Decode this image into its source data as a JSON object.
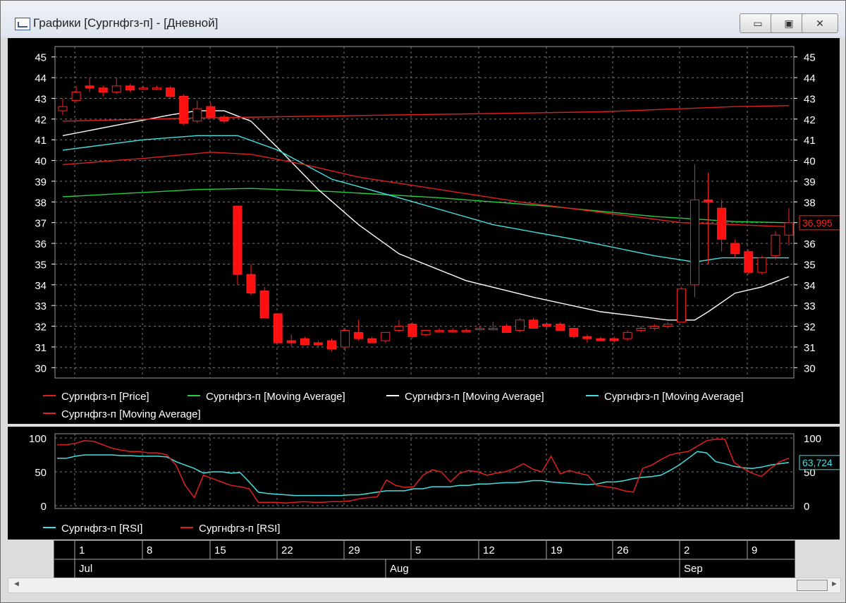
{
  "window": {
    "title": "Графики [Сургнфгз-п] - [Дневной]",
    "minimize_label": "▭",
    "maximize_label": "▣",
    "close_label": "✕"
  },
  "price_panel": {
    "y_ticks": [
      30,
      31,
      32,
      33,
      34,
      35,
      36,
      37,
      38,
      39,
      40,
      41,
      42,
      43,
      44,
      45
    ],
    "last_price_label": "36,995",
    "legend": [
      {
        "text": "Сургнфгз-п [Price]",
        "color": "#e02020"
      },
      {
        "text": "Сургнфгз-п [Moving Average]",
        "color": "#20d040"
      },
      {
        "text": "Сургнфгз-п [Moving Average]",
        "color": "#ffffff"
      },
      {
        "text": "Сургнфгз-п [Moving Average]",
        "color": "#40e0e0"
      },
      {
        "text": "Сургнфгз-п [Moving Average]",
        "color": "#e02020"
      }
    ]
  },
  "rsi_panel": {
    "y_ticks": [
      0,
      50,
      100
    ],
    "last_rsi_label": "63,724",
    "legend": [
      {
        "text": "Сургнфгз-п [RSI]",
        "color": "#40e0e0"
      },
      {
        "text": "Сургнфгз-п [RSI]",
        "color": "#e02020"
      }
    ]
  },
  "date_axis": {
    "days": [
      "1",
      "8",
      "15",
      "22",
      "29",
      "5",
      "12",
      "19",
      "26",
      "2",
      "9"
    ],
    "months": [
      "Jul",
      "Aug",
      "Sep"
    ]
  },
  "chart_data": [
    {
      "type": "candlestick",
      "ylim": [
        29.5,
        45.5
      ],
      "candles": [
        {
          "o": 42.4,
          "h": 43.0,
          "l": 42.2,
          "c": 42.6,
          "color": "red"
        },
        {
          "o": 42.9,
          "h": 43.6,
          "l": 42.8,
          "c": 43.3,
          "color": "red"
        },
        {
          "o": 43.6,
          "h": 44.0,
          "l": 43.3,
          "c": 43.5,
          "color": "red"
        },
        {
          "o": 43.5,
          "h": 43.6,
          "l": 43.1,
          "c": 43.3,
          "color": "red"
        },
        {
          "o": 43.3,
          "h": 44.0,
          "l": 43.2,
          "c": 43.6,
          "color": "red"
        },
        {
          "o": 43.6,
          "h": 43.7,
          "l": 43.3,
          "c": 43.4,
          "color": "red"
        },
        {
          "o": 43.5,
          "h": 43.6,
          "l": 43.4,
          "c": 43.5,
          "color": "red"
        },
        {
          "o": 43.5,
          "h": 43.6,
          "l": 43.4,
          "c": 43.5,
          "color": "red"
        },
        {
          "o": 43.5,
          "h": 43.6,
          "l": 43.0,
          "c": 43.1,
          "color": "red"
        },
        {
          "o": 43.1,
          "h": 43.2,
          "l": 41.7,
          "c": 41.8,
          "color": "red"
        },
        {
          "o": 41.9,
          "h": 42.9,
          "l": 41.8,
          "c": 42.5,
          "color": "red"
        },
        {
          "o": 42.6,
          "h": 42.8,
          "l": 42.0,
          "c": 42.1,
          "color": "red"
        },
        {
          "o": 42.1,
          "h": 42.2,
          "l": 41.8,
          "c": 41.9,
          "color": "red"
        },
        {
          "o": 37.8,
          "h": 37.8,
          "l": 34.0,
          "c": 34.5,
          "color": "red"
        },
        {
          "o": 34.5,
          "h": 35.0,
          "l": 33.5,
          "c": 33.6,
          "color": "red"
        },
        {
          "o": 33.7,
          "h": 33.9,
          "l": 32.4,
          "c": 32.4,
          "color": "red"
        },
        {
          "o": 32.6,
          "h": 32.6,
          "l": 31.2,
          "c": 31.2,
          "color": "red"
        },
        {
          "o": 31.3,
          "h": 31.6,
          "l": 31.0,
          "c": 31.2,
          "color": "red"
        },
        {
          "o": 31.4,
          "h": 31.5,
          "l": 31.1,
          "c": 31.1,
          "color": "red"
        },
        {
          "o": 31.2,
          "h": 31.3,
          "l": 31.0,
          "c": 31.1,
          "color": "red"
        },
        {
          "o": 31.3,
          "h": 31.4,
          "l": 30.8,
          "c": 30.9,
          "color": "red"
        },
        {
          "o": 31.0,
          "h": 31.9,
          "l": 30.8,
          "c": 31.8,
          "color": "red"
        },
        {
          "o": 31.7,
          "h": 32.3,
          "l": 31.3,
          "c": 31.4,
          "color": "red"
        },
        {
          "o": 31.4,
          "h": 31.5,
          "l": 31.2,
          "c": 31.2,
          "color": "red"
        },
        {
          "o": 31.3,
          "h": 31.7,
          "l": 31.2,
          "c": 31.7,
          "color": "red"
        },
        {
          "o": 31.8,
          "h": 32.3,
          "l": 31.7,
          "c": 32.0,
          "color": "red"
        },
        {
          "o": 32.1,
          "h": 32.2,
          "l": 31.4,
          "c": 31.5,
          "color": "red"
        },
        {
          "o": 31.6,
          "h": 31.8,
          "l": 31.5,
          "c": 31.8,
          "color": "red"
        },
        {
          "o": 31.8,
          "h": 31.9,
          "l": 31.7,
          "c": 31.8,
          "color": "red"
        },
        {
          "o": 31.8,
          "h": 31.9,
          "l": 31.7,
          "c": 31.8,
          "color": "red"
        },
        {
          "o": 31.8,
          "h": 31.9,
          "l": 31.7,
          "c": 31.8,
          "color": "red"
        },
        {
          "o": 31.9,
          "h": 32.0,
          "l": 31.8,
          "c": 31.9,
          "color": "red"
        },
        {
          "o": 31.9,
          "h": 32.2,
          "l": 31.8,
          "c": 31.9,
          "color": "red"
        },
        {
          "o": 32.0,
          "h": 32.1,
          "l": 31.7,
          "c": 31.7,
          "color": "red"
        },
        {
          "o": 31.8,
          "h": 32.4,
          "l": 31.7,
          "c": 32.3,
          "color": "red"
        },
        {
          "o": 32.3,
          "h": 32.4,
          "l": 31.9,
          "c": 31.9,
          "color": "red"
        },
        {
          "o": 32.1,
          "h": 32.2,
          "l": 31.9,
          "c": 32.0,
          "color": "red"
        },
        {
          "o": 32.1,
          "h": 32.2,
          "l": 31.8,
          "c": 31.8,
          "color": "red"
        },
        {
          "o": 31.9,
          "h": 31.9,
          "l": 31.4,
          "c": 31.5,
          "color": "red"
        },
        {
          "o": 31.5,
          "h": 31.6,
          "l": 31.2,
          "c": 31.4,
          "color": "red"
        },
        {
          "o": 31.4,
          "h": 31.5,
          "l": 31.3,
          "c": 31.3,
          "color": "red"
        },
        {
          "o": 31.4,
          "h": 31.5,
          "l": 31.2,
          "c": 31.3,
          "color": "red"
        },
        {
          "o": 31.4,
          "h": 31.8,
          "l": 31.3,
          "c": 31.7,
          "color": "red"
        },
        {
          "o": 31.8,
          "h": 32.0,
          "l": 31.7,
          "c": 31.9,
          "color": "red"
        },
        {
          "o": 31.9,
          "h": 32.1,
          "l": 31.8,
          "c": 32.0,
          "color": "red"
        },
        {
          "o": 32.0,
          "h": 32.2,
          "l": 31.9,
          "c": 32.1,
          "color": "red"
        },
        {
          "o": 32.2,
          "h": 33.9,
          "l": 32.2,
          "c": 33.8,
          "color": "red"
        },
        {
          "o": 34.0,
          "h": 39.8,
          "l": 33.4,
          "c": 38.1,
          "color": "red"
        },
        {
          "o": 38.1,
          "h": 39.4,
          "l": 35.0,
          "c": 38.0,
          "color": "red"
        },
        {
          "o": 37.7,
          "h": 38.1,
          "l": 35.6,
          "c": 36.2,
          "color": "red"
        },
        {
          "o": 36.0,
          "h": 36.2,
          "l": 35.3,
          "c": 35.5,
          "color": "red"
        },
        {
          "o": 35.6,
          "h": 35.7,
          "l": 34.5,
          "c": 34.6,
          "color": "red"
        },
        {
          "o": 34.6,
          "h": 35.4,
          "l": 34.5,
          "c": 35.3,
          "color": "red"
        },
        {
          "o": 35.4,
          "h": 36.6,
          "l": 35.2,
          "c": 36.4,
          "color": "red"
        },
        {
          "o": 36.4,
          "h": 37.7,
          "l": 35.9,
          "c": 36.995,
          "color": "red"
        }
      ],
      "moving_averages": [
        {
          "color": "#20d040",
          "points": [
            [
              0,
              38.25
            ],
            [
              10,
              38.6
            ],
            [
              14,
              38.65
            ],
            [
              20,
              38.5
            ],
            [
              28,
              38.2
            ],
            [
              36,
              37.8
            ],
            [
              44,
              37.3
            ],
            [
              50,
              37.05
            ],
            [
              54,
              36.995
            ]
          ]
        },
        {
          "color": "#ffffff",
          "points": [
            [
              0,
              41.2
            ],
            [
              4,
              41.7
            ],
            [
              8,
              42.2
            ],
            [
              10,
              42.4
            ],
            [
              12,
              42.4
            ],
            [
              14,
              41.9
            ],
            [
              16,
              40.6
            ],
            [
              19,
              38.6
            ],
            [
              22,
              36.9
            ],
            [
              25,
              35.5
            ],
            [
              30,
              34.2
            ],
            [
              35,
              33.4
            ],
            [
              40,
              32.7
            ],
            [
              45,
              32.3
            ],
            [
              47,
              32.3
            ],
            [
              48,
              32.7
            ],
            [
              50,
              33.6
            ],
            [
              52,
              33.9
            ],
            [
              54,
              34.4
            ]
          ]
        },
        {
          "color": "#40e0e0",
          "points": [
            [
              0,
              40.5
            ],
            [
              6,
              41.0
            ],
            [
              10,
              41.2
            ],
            [
              13,
              41.2
            ],
            [
              16,
              40.5
            ],
            [
              20,
              39.1
            ],
            [
              25,
              38.2
            ],
            [
              32,
              36.9
            ],
            [
              38,
              36.2
            ],
            [
              44,
              35.4
            ],
            [
              47,
              35.1
            ],
            [
              49,
              35.3
            ],
            [
              54,
              35.3
            ]
          ]
        },
        {
          "color": "#e02020",
          "points": [
            [
              0,
              39.8
            ],
            [
              6,
              40.1
            ],
            [
              11,
              40.4
            ],
            [
              14,
              40.3
            ],
            [
              18,
              39.8
            ],
            [
              22,
              39.2
            ],
            [
              28,
              38.6
            ],
            [
              34,
              38.0
            ],
            [
              40,
              37.5
            ],
            [
              46,
              37.0
            ],
            [
              50,
              36.9
            ],
            [
              54,
              36.8
            ]
          ]
        },
        {
          "color": "#e02020",
          "points": [
            [
              0,
              41.9
            ],
            [
              10,
              42.05
            ],
            [
              20,
              42.15
            ],
            [
              30,
              42.25
            ],
            [
              40,
              42.35
            ],
            [
              50,
              42.6
            ],
            [
              54,
              42.65
            ]
          ]
        }
      ]
    },
    {
      "type": "line",
      "ylim": [
        0,
        100
      ],
      "series": [
        {
          "color": "#40e0e0",
          "values": [
            70,
            70,
            73,
            75,
            75,
            75,
            75,
            74,
            74,
            73,
            73,
            73,
            72,
            65,
            60,
            55,
            48,
            50,
            50,
            48,
            49,
            35,
            20,
            18,
            17,
            16,
            15,
            15,
            15,
            15,
            15,
            15,
            16,
            16,
            18,
            20,
            22,
            22,
            22,
            25,
            25,
            28,
            28,
            28,
            30,
            30,
            32,
            32,
            33,
            34,
            34,
            35,
            37,
            37,
            35,
            34,
            33,
            32,
            31,
            32,
            35,
            35,
            37,
            40,
            42,
            43,
            45,
            52,
            60,
            70,
            80,
            78,
            65,
            62,
            58,
            56,
            55,
            57,
            60,
            62,
            63.7
          ]
        },
        {
          "color": "#e02020",
          "values": [
            90,
            90,
            92,
            96,
            95,
            90,
            85,
            82,
            80,
            80,
            78,
            78,
            75,
            60,
            30,
            12,
            45,
            40,
            35,
            30,
            28,
            25,
            5,
            5,
            5,
            4,
            5,
            6,
            5,
            5,
            6,
            6,
            7,
            10,
            12,
            13,
            38,
            30,
            27,
            28,
            45,
            53,
            50,
            35,
            48,
            52,
            50,
            45,
            48,
            50,
            55,
            62,
            54,
            50,
            73,
            47,
            52,
            48,
            45,
            30,
            28,
            26,
            22,
            20,
            55,
            60,
            68,
            75,
            78,
            80,
            88,
            96,
            98,
            98,
            64,
            55,
            48,
            43,
            55,
            65,
            70
          ]
        }
      ]
    }
  ]
}
